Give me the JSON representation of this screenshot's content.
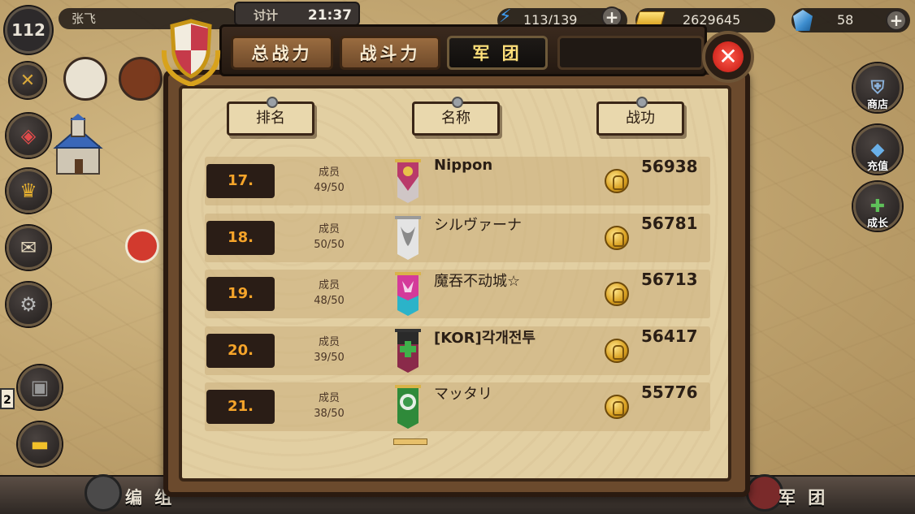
{
  "hud": {
    "level": "112",
    "player_name": "张飞",
    "tab_partial": "讨计",
    "time": "21:37",
    "energy": "113/139",
    "gold": "2629645",
    "gems": "58"
  },
  "tabs": [
    {
      "label": "总战力",
      "active": false
    },
    {
      "label": "战斗力",
      "active": false
    },
    {
      "label": "军 团",
      "active": true
    }
  ],
  "columns": {
    "rank": "排名",
    "name": "名称",
    "merit": "战功"
  },
  "member_label": "成员",
  "guilds": [
    {
      "rank": "17.",
      "members": "49/50",
      "name": "Nippon",
      "power": "56938",
      "banner_color": "#b93a6a"
    },
    {
      "rank": "18.",
      "members": "50/50",
      "name": "シルヴァーナ",
      "power": "56781",
      "banner_color": "#cfcfcf"
    },
    {
      "rank": "19.",
      "members": "48/50",
      "name": "魔吞不动城☆",
      "power": "56713",
      "banner_color": "#d43a9a"
    },
    {
      "rank": "20.",
      "members": "39/50",
      "name": "[KOR]각개전투",
      "power": "56417",
      "banner_color": "#8a2a4a"
    },
    {
      "rank": "21.",
      "members": "38/50",
      "name": "マッタリ",
      "power": "55776",
      "banner_color": "#2f8a3a"
    }
  ],
  "right_menu": {
    "shop": "商店",
    "recharge": "充值",
    "growth": "成长"
  },
  "bottom_bar": {
    "formation": "编 组",
    "legion": "军 团"
  },
  "side_badge": "2",
  "colors": {
    "rank_text": "#f5a42a",
    "active_tab_text": "#ffe07a",
    "close": "#e0241b"
  }
}
